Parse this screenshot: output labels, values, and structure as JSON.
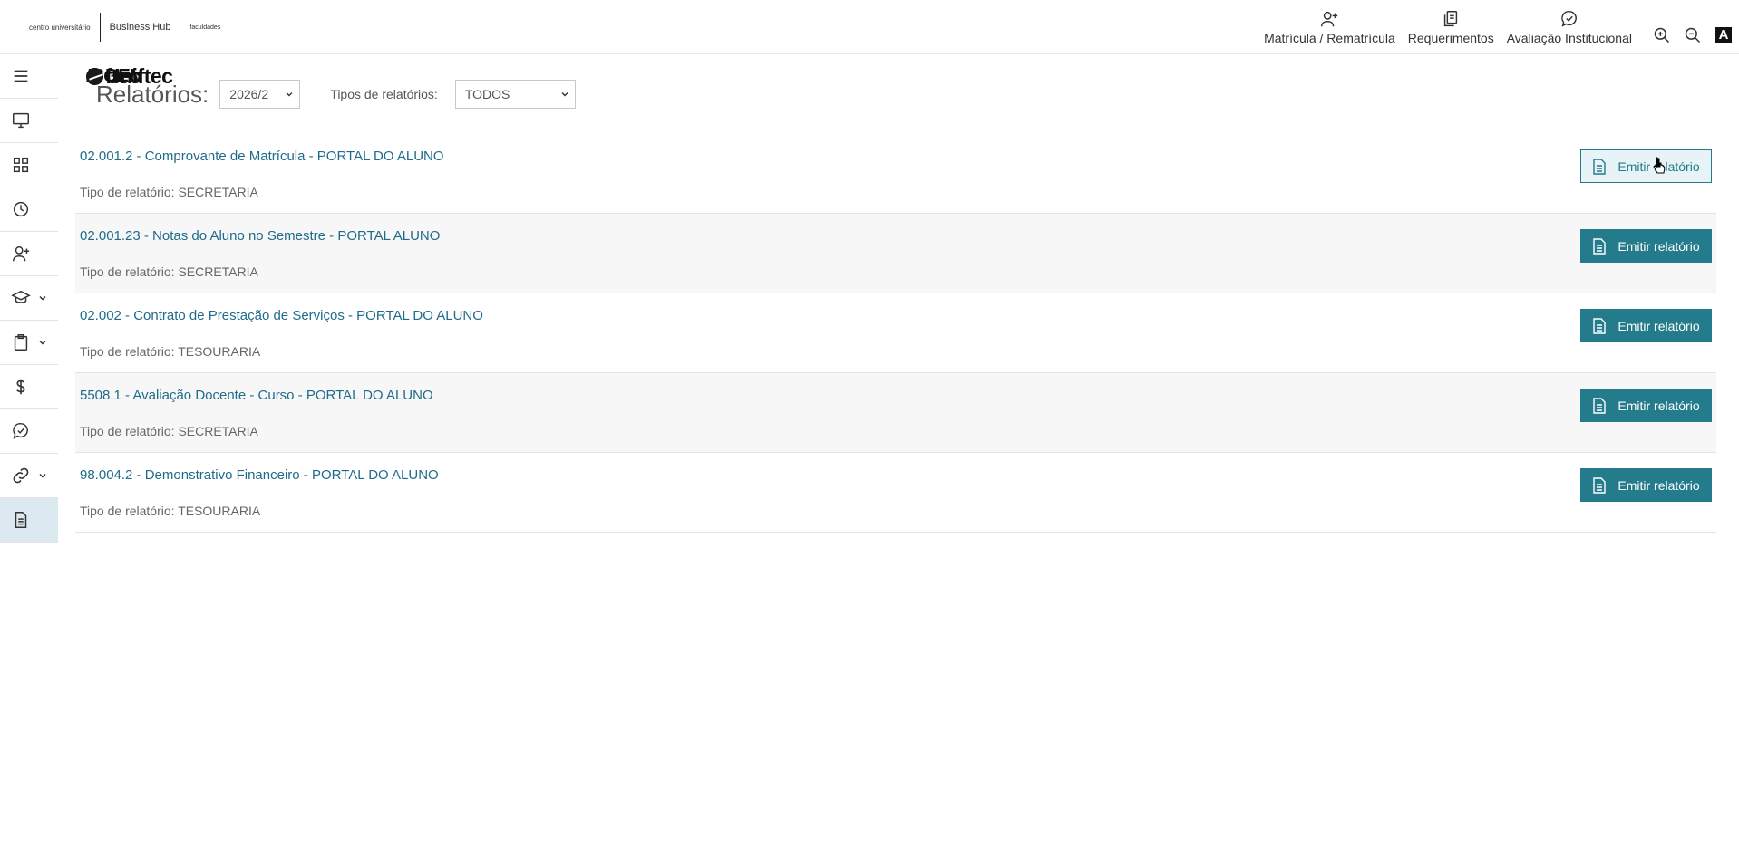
{
  "header": {
    "logos": {
      "uniftec": {
        "name": "Uniftec",
        "sub": "centro universitário"
      },
      "ibgen": {
        "name": "IBGEN",
        "sub": "Business Hub"
      },
      "ftec": {
        "name": "ftec",
        "sub": "faculdades"
      }
    },
    "nav": [
      {
        "label": "Matrícula / Rematrícula",
        "icon": "user-plus-icon"
      },
      {
        "label": "Requerimentos",
        "icon": "documents-icon"
      },
      {
        "label": "Avaliação Institucional",
        "icon": "chat-check-icon"
      }
    ],
    "tools": {
      "zoom_in": "zoom-in-icon",
      "zoom_out": "zoom-out-icon",
      "contrast_label": "A"
    }
  },
  "sidebar": {
    "items": [
      {
        "icon": "hamburger-menu-icon"
      },
      {
        "icon": "monitor-icon"
      },
      {
        "icon": "grid-icon"
      },
      {
        "icon": "clock-icon"
      },
      {
        "icon": "user-plus-icon"
      },
      {
        "icon": "graduation-cap-icon",
        "expandable": true
      },
      {
        "icon": "clipboard-icon",
        "expandable": true
      },
      {
        "icon": "dollar-icon"
      },
      {
        "icon": "chat-check-icon"
      },
      {
        "icon": "link-icon",
        "expandable": true
      },
      {
        "icon": "document-icon",
        "active": true
      }
    ]
  },
  "filters": {
    "title": "Relatórios:",
    "period_value": "2026/2",
    "type_label": "Tipos de relatórios:",
    "type_value": "TODOS"
  },
  "reports": [
    {
      "title": "02.001.2 - Comprovante de Matrícula - PORTAL DO ALUNO",
      "type_key": "Tipo de relatório:",
      "type_value": "SECRETARIA",
      "button": "Emitir relatório"
    },
    {
      "title": "02.001.23 - Notas do Aluno no Semestre - PORTAL ALUNO",
      "type_key": "Tipo de relatório:",
      "type_value": "SECRETARIA",
      "button": "Emitir relatório"
    },
    {
      "title": "02.002 - Contrato de Prestação de Serviços - PORTAL DO ALUNO",
      "type_key": "Tipo de relatório:",
      "type_value": "TESOURARIA",
      "button": "Emitir relatório"
    },
    {
      "title": "5508.1 - Avaliação Docente - Curso - PORTAL DO ALUNO",
      "type_key": "Tipo de relatório:",
      "type_value": "SECRETARIA",
      "button": "Emitir relatório"
    },
    {
      "title": "98.004.2 - Demonstrativo Financeiro - PORTAL DO ALUNO",
      "type_key": "Tipo de relatório:",
      "type_value": "TESOURARIA",
      "button": "Emitir relatório"
    }
  ],
  "colors": {
    "accent": "#247b8b",
    "link": "#1f6b8a",
    "active_sidebar": "#dde9f0"
  }
}
